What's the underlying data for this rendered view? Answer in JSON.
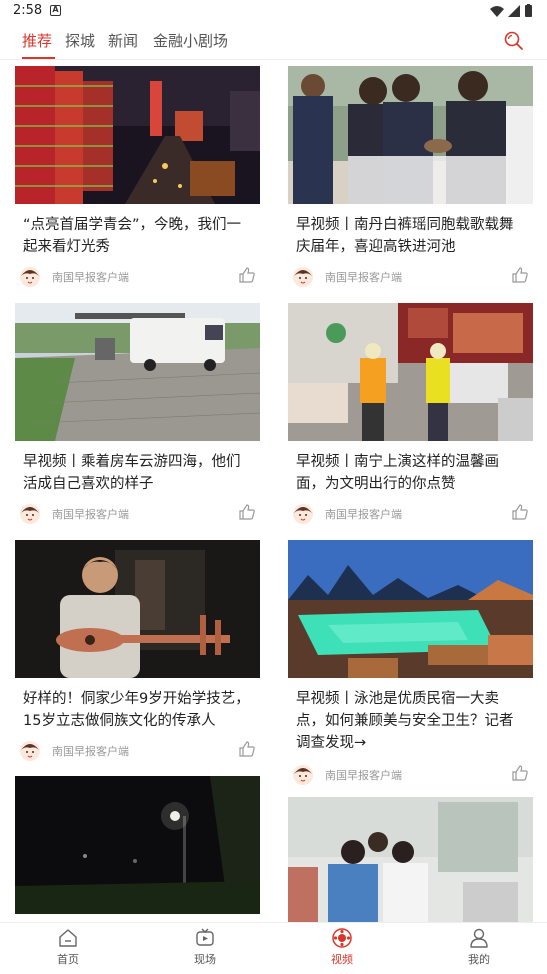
{
  "status": {
    "time": "2:58",
    "notification_icon": "A"
  },
  "tabs": [
    {
      "label": "推荐"
    },
    {
      "label": "探城"
    },
    {
      "label": "新闻"
    },
    {
      "label": "金融小剧场"
    }
  ],
  "feed": [
    {
      "title": "“点亮首届学青会”，今晚，我们一起来看灯光秀",
      "source": "南国早报客户端"
    },
    {
      "title": "早视频丨南丹白裤瑶同胞载歌载舞庆届年，喜迎高铁进河池",
      "source": "南国早报客户端"
    },
    {
      "title": "早视频丨乘着房车云游四海，他们活成自己喜欢的样子",
      "source": "南国早报客户端"
    },
    {
      "title": "早视频丨南宁上演这样的温馨画面，为文明出行的你点赞",
      "source": "南国早报客户端"
    },
    {
      "title": "好样的！侗家少年9岁开始学技艺，15岁立志做侗族文化的传承人",
      "source": "南国早报客户端"
    },
    {
      "title": "早视频丨泳池是优质民宿一大卖点，如何兼顾美与安全卫生？记者调查发现→",
      "source": "南国早报客户端"
    },
    {
      "title": "",
      "source": ""
    },
    {
      "title": "",
      "source": ""
    }
  ],
  "bottom_nav": [
    {
      "label": "首页",
      "icon": "home-icon"
    },
    {
      "label": "现场",
      "icon": "tv-icon"
    },
    {
      "label": "视频",
      "icon": "video-icon"
    },
    {
      "label": "我的",
      "icon": "profile-icon"
    }
  ],
  "colors": {
    "accent": "#d9372c"
  }
}
